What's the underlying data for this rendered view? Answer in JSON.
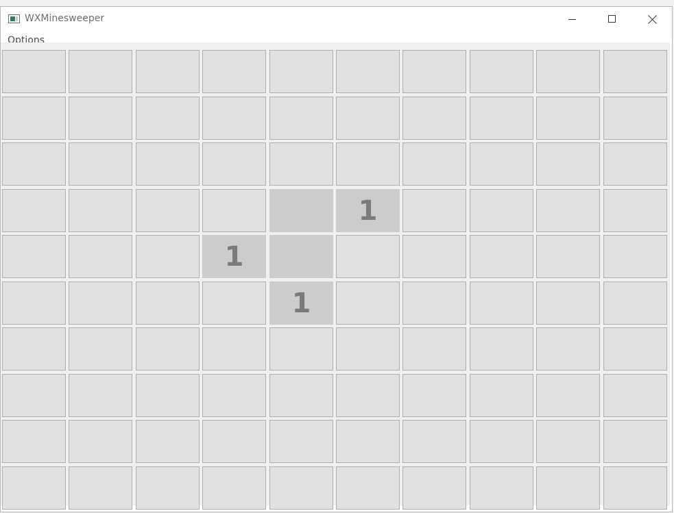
{
  "window": {
    "title": "WXMinesweeper"
  },
  "menu": {
    "options_label": "Options"
  },
  "board": {
    "rows": 10,
    "cols": 10,
    "revealed": [
      {
        "row": 3,
        "col": 4,
        "value": ""
      },
      {
        "row": 3,
        "col": 5,
        "value": "1"
      },
      {
        "row": 4,
        "col": 3,
        "value": "1"
      },
      {
        "row": 4,
        "col": 4,
        "value": ""
      },
      {
        "row": 5,
        "col": 4,
        "value": "1"
      }
    ]
  },
  "colors": {
    "cell_hidden": "#e1e1e1",
    "cell_revealed": "#cccccc",
    "number_text": "#7a7a7a"
  }
}
